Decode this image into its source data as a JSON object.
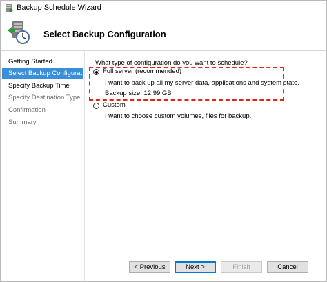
{
  "window": {
    "title": "Backup Schedule Wizard",
    "title_icon": "backup-app-icon"
  },
  "header": {
    "icon": "backup-schedule-clock-icon",
    "title": "Select Backup Configuration"
  },
  "nav": {
    "items": [
      {
        "label": "Getting Started",
        "state": "normal"
      },
      {
        "label": "Select Backup Configurat...",
        "state": "active"
      },
      {
        "label": "Specify Backup Time",
        "state": "normal"
      },
      {
        "label": "Specify Destination Type",
        "state": "disabled"
      },
      {
        "label": "Confirmation",
        "state": "disabled"
      },
      {
        "label": "Summary",
        "state": "disabled"
      }
    ]
  },
  "main": {
    "question": "What type of configuration do you want to schedule?",
    "options": [
      {
        "label": "Full server (recommended)",
        "selected": true,
        "description": "I want to back up all my server data, applications and system state.",
        "detail": "Backup size: 12.99 GB"
      },
      {
        "label": "Custom",
        "selected": false,
        "description": "I want to choose custom volumes, files for backup."
      }
    ]
  },
  "footer": {
    "previous_label": "< Previous",
    "next_label": "Next >",
    "finish_label": "Finish",
    "cancel_label": "Cancel"
  },
  "colors": {
    "nav_active": "#3a8fd8",
    "highlight_border": "#e2231a",
    "default_button_border": "#0078d7"
  }
}
